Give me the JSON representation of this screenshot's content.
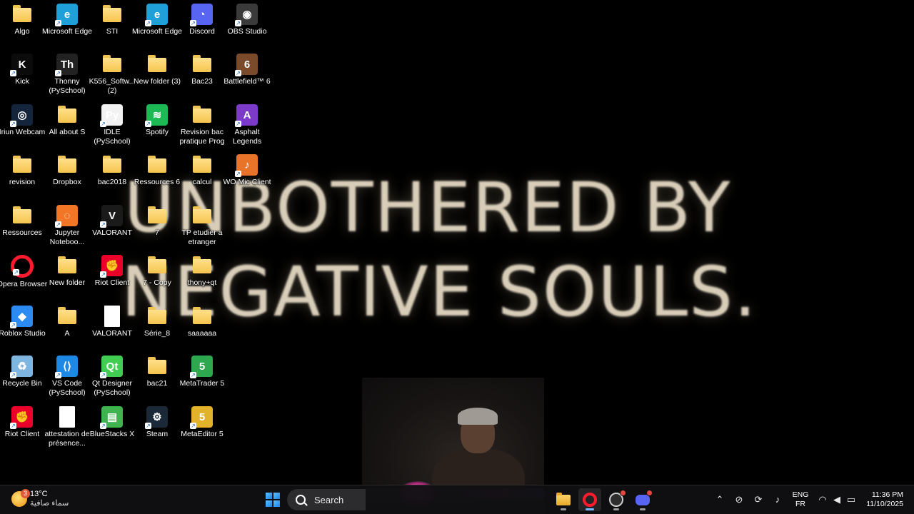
{
  "wallpaper": {
    "line1": "UNBOTHERED BY",
    "line2": "NEGATIVE SOULS."
  },
  "desktop_icons": [
    {
      "label": "Algo",
      "icon": "folder-icon",
      "kind": "folder"
    },
    {
      "label": "Microsoft Edge",
      "icon": "edge-icon",
      "kind": "app",
      "color": "#1fa0d8"
    },
    {
      "label": "STI",
      "icon": "folder-icon",
      "kind": "folder"
    },
    {
      "label": "Microsoft Edge",
      "icon": "edge-icon",
      "kind": "app",
      "color": "#1fa0d8"
    },
    {
      "label": "Discord",
      "icon": "discord-icon",
      "kind": "app",
      "color": "#5865f2"
    },
    {
      "label": "OBS Studio",
      "icon": "obs-icon",
      "kind": "app",
      "color": "#3a3a3a"
    },
    {
      "label": "Kick",
      "icon": "kick-icon",
      "kind": "app",
      "color": "#0b0b0b"
    },
    {
      "label": "Thonny (PySchool)",
      "icon": "thonny-icon",
      "kind": "app",
      "color": "#222222"
    },
    {
      "label": "K556_Softw... (2)",
      "icon": "folder-icon",
      "kind": "folder"
    },
    {
      "label": "New folder (3)",
      "icon": "folder-icon",
      "kind": "folder"
    },
    {
      "label": "Bac23",
      "icon": "folder-icon",
      "kind": "folder"
    },
    {
      "label": "Battlefield™ 6",
      "icon": "battlefield-icon",
      "kind": "app",
      "color": "#7a4a2a"
    },
    {
      "label": "Iriun Webcam",
      "icon": "webcam-icon",
      "kind": "app",
      "color": "#14243a"
    },
    {
      "label": "All about S",
      "icon": "folder-icon",
      "kind": "folder"
    },
    {
      "label": "IDLE (PySchool)",
      "icon": "idle-icon",
      "kind": "app",
      "color": "#f2f2f2"
    },
    {
      "label": "Spotify",
      "icon": "spotify-icon",
      "kind": "app",
      "color": "#1db954"
    },
    {
      "label": "Revision bac pratique Prog",
      "icon": "folder-icon",
      "kind": "folder"
    },
    {
      "label": "Asphalt Legends",
      "icon": "asphalt-icon",
      "kind": "app",
      "color": "#7c3ac9"
    },
    {
      "label": "revision",
      "icon": "folder-icon",
      "kind": "folder"
    },
    {
      "label": "Dropbox",
      "icon": "folder-icon",
      "kind": "folder"
    },
    {
      "label": "bac2018",
      "icon": "folder-icon",
      "kind": "folder"
    },
    {
      "label": "Ressources 6",
      "icon": "folder-icon",
      "kind": "folder"
    },
    {
      "label": "calcul",
      "icon": "folder-icon",
      "kind": "folder"
    },
    {
      "label": "WO Mic Client",
      "icon": "microphone-icon",
      "kind": "app",
      "color": "#e8742a"
    },
    {
      "label": "Ressources",
      "icon": "folder-icon",
      "kind": "folder"
    },
    {
      "label": "Jupyter Noteboo...",
      "icon": "jupyter-icon",
      "kind": "app",
      "color": "#f37626"
    },
    {
      "label": "VALORANT",
      "icon": "valorant-icon",
      "kind": "app",
      "color": "#1a1a1a"
    },
    {
      "label": "7",
      "icon": "folder-icon",
      "kind": "folder"
    },
    {
      "label": "TP etudier a etranger",
      "icon": "folder-icon",
      "kind": "folder"
    },
    {
      "label": "",
      "icon": "",
      "kind": "none"
    },
    {
      "label": "Opera Browser",
      "icon": "opera-icon",
      "kind": "app",
      "color": "#ff1b2d"
    },
    {
      "label": "New folder",
      "icon": "folder-icon",
      "kind": "folder"
    },
    {
      "label": "Riot Client",
      "icon": "riot-client-icon",
      "kind": "app",
      "color": "#eb0029"
    },
    {
      "label": "7 - Copy",
      "icon": "folder-icon",
      "kind": "folder"
    },
    {
      "label": "thony+qt",
      "icon": "folder-icon",
      "kind": "folder"
    },
    {
      "label": "",
      "icon": "",
      "kind": "none"
    },
    {
      "label": "Roblox Studio",
      "icon": "roblox-studio-icon",
      "kind": "app",
      "color": "#2b8bf2"
    },
    {
      "label": "A",
      "icon": "folder-icon",
      "kind": "folder"
    },
    {
      "label": "VALORANT",
      "icon": "document-icon",
      "kind": "doc",
      "color": "#ffffff"
    },
    {
      "label": "Série_8",
      "icon": "folder-icon",
      "kind": "folder"
    },
    {
      "label": "saaaaaa",
      "icon": "folder-icon",
      "kind": "folder"
    },
    {
      "label": "",
      "icon": "",
      "kind": "none"
    },
    {
      "label": "Recycle Bin",
      "icon": "recycle-bin-icon",
      "kind": "app",
      "color": "#7fb6e0"
    },
    {
      "label": "VS Code (PySchool)",
      "icon": "vscode-icon",
      "kind": "app",
      "color": "#1e88e5"
    },
    {
      "label": "Qt Designer (PySchool)",
      "icon": "qt-designer-icon",
      "kind": "app",
      "color": "#41cd52"
    },
    {
      "label": "bac21",
      "icon": "folder-icon",
      "kind": "folder"
    },
    {
      "label": "MetaTrader 5",
      "icon": "metatrader-icon",
      "kind": "app",
      "color": "#2ea84f"
    },
    {
      "label": "",
      "icon": "",
      "kind": "none"
    },
    {
      "label": "Riot Client",
      "icon": "riot-client-icon",
      "kind": "app",
      "color": "#eb0029"
    },
    {
      "label": "attestation de présence...",
      "icon": "document-icon",
      "kind": "doc",
      "color": "#ffffff"
    },
    {
      "label": "BlueStacks X",
      "icon": "bluestacks-icon",
      "kind": "app",
      "color": "#3fb34f"
    },
    {
      "label": "Steam",
      "icon": "steam-icon",
      "kind": "app",
      "color": "#1b2838"
    },
    {
      "label": "MetaEditor 5",
      "icon": "metaeditor-icon",
      "kind": "app",
      "color": "#e2b32a"
    },
    {
      "label": "",
      "icon": "",
      "kind": "none"
    }
  ],
  "taskbar": {
    "weather": {
      "temp": "13°C",
      "condition": "سماء صافية",
      "badge": "3"
    },
    "search_label": "Search",
    "apps": [
      {
        "name": "file-explorer",
        "active": false
      },
      {
        "name": "opera",
        "active": true
      },
      {
        "name": "obs",
        "active": false
      },
      {
        "name": "discord",
        "active": false
      }
    ],
    "lang_primary": "ENG",
    "lang_secondary": "FR",
    "time": "11:36 PM",
    "date": "11/10/2025"
  }
}
